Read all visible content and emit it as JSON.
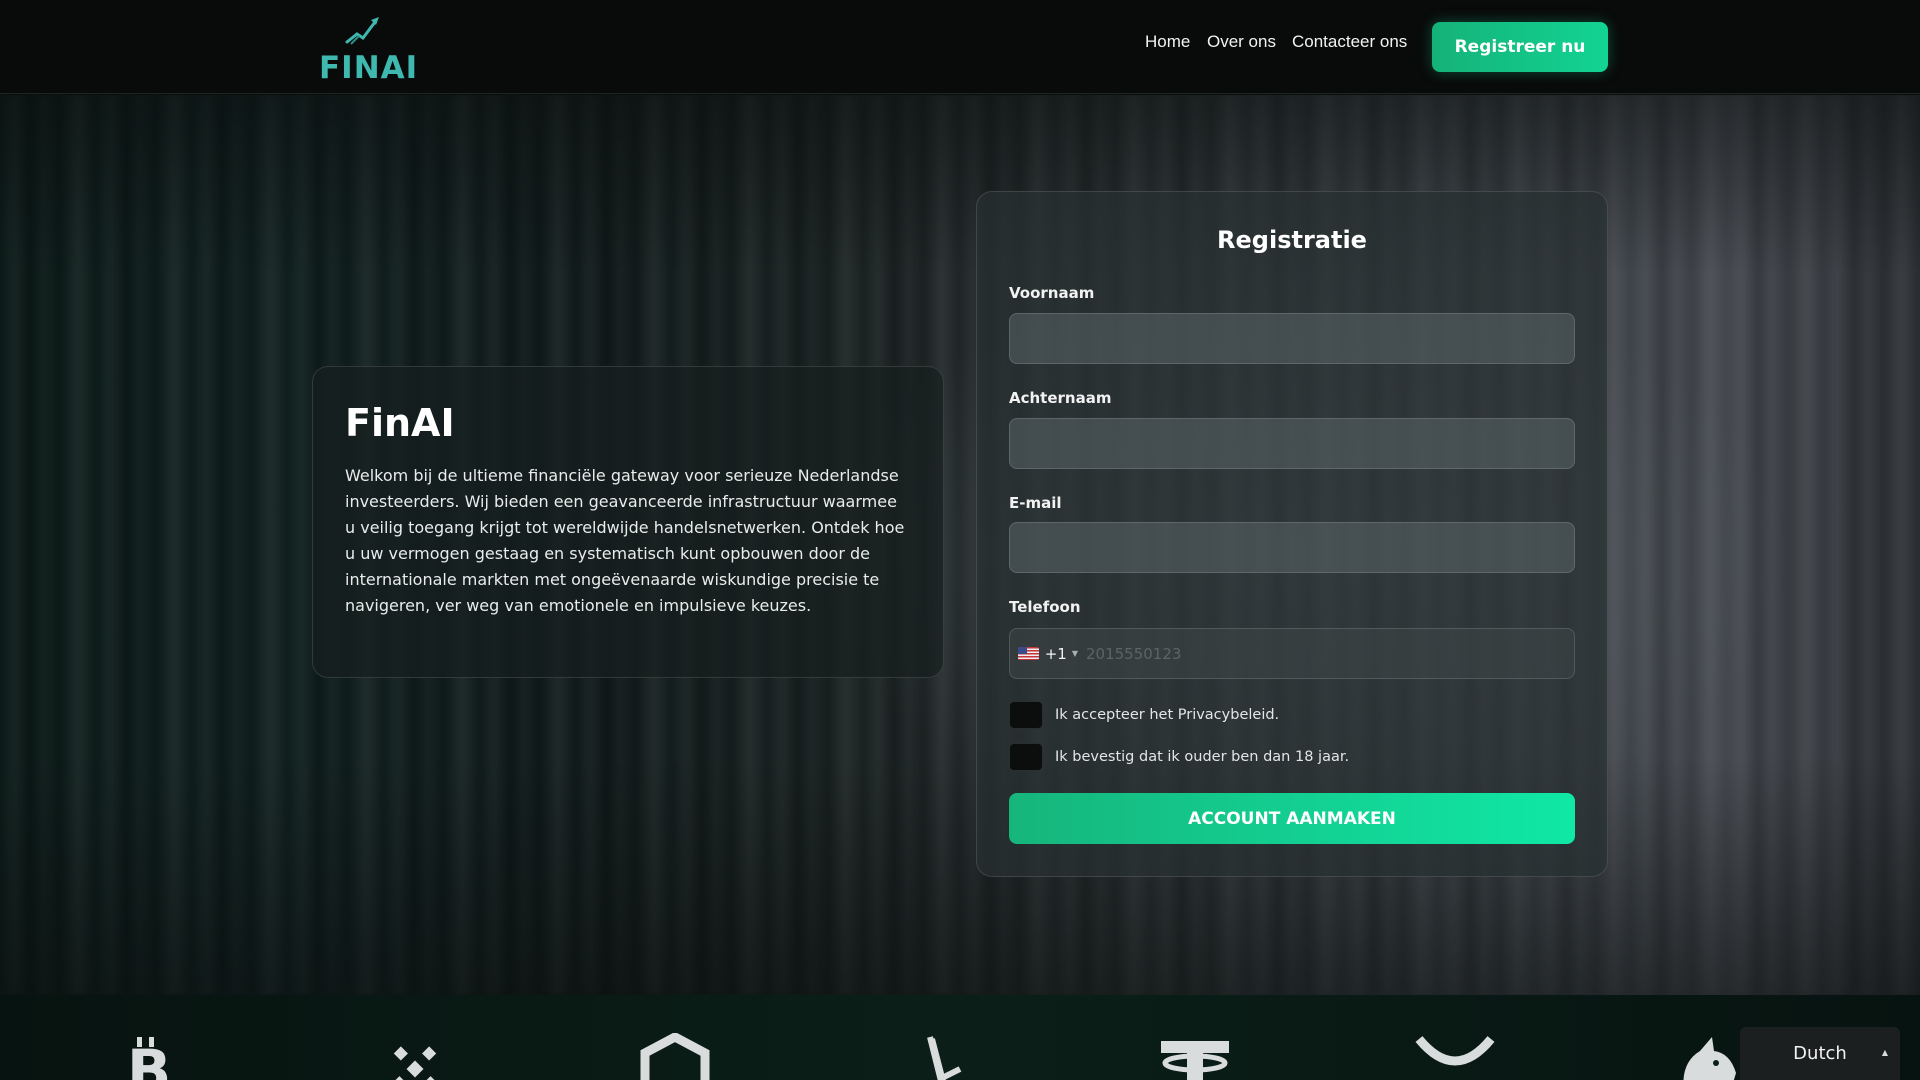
{
  "header": {
    "logo_text": "FINAI",
    "nav": {
      "home": "Home",
      "about": "Over ons",
      "contact": "Contacteer ons"
    },
    "cta_label": "Registreer nu"
  },
  "intro": {
    "title": "FinAI",
    "text": "Welkom bij de ultieme financiële gateway voor serieuze Nederlandse investeerders. Wij bieden een geavanceerde infrastructuur waarmee u veilig toegang krijgt tot wereldwijde handelsnetwerken. Ontdek hoe u uw vermogen gestaag en systematisch kunt opbouwen door de internationale markten met ongeëvenaarde wiskundige precisie te navigeren, ver weg van emotionele en impulsieve keuzes."
  },
  "form": {
    "title": "Registratie",
    "first_name_label": "Voornaam",
    "last_name_label": "Achternaam",
    "email_label": "E-mail",
    "phone_label": "Telefoon",
    "phone_dial_code": "+1",
    "phone_placeholder": "2015550123",
    "privacy_label": "Ik accepteer het Privacybeleid.",
    "age_label": "Ik bevestig dat ik ouder ben dan 18 jaar.",
    "submit_label": "ACCOUNT AANMAKEN"
  },
  "coins": [
    "bitcoin-icon",
    "binance-icon",
    "chainlink-icon",
    "solana-icon",
    "tether-icon",
    "xrp-icon",
    "unicorn-icon"
  ],
  "language": {
    "selected": "Dutch"
  },
  "colors": {
    "accent": "#14c98a",
    "logo": "#3fb9b0",
    "background": "#0c0d0d"
  }
}
